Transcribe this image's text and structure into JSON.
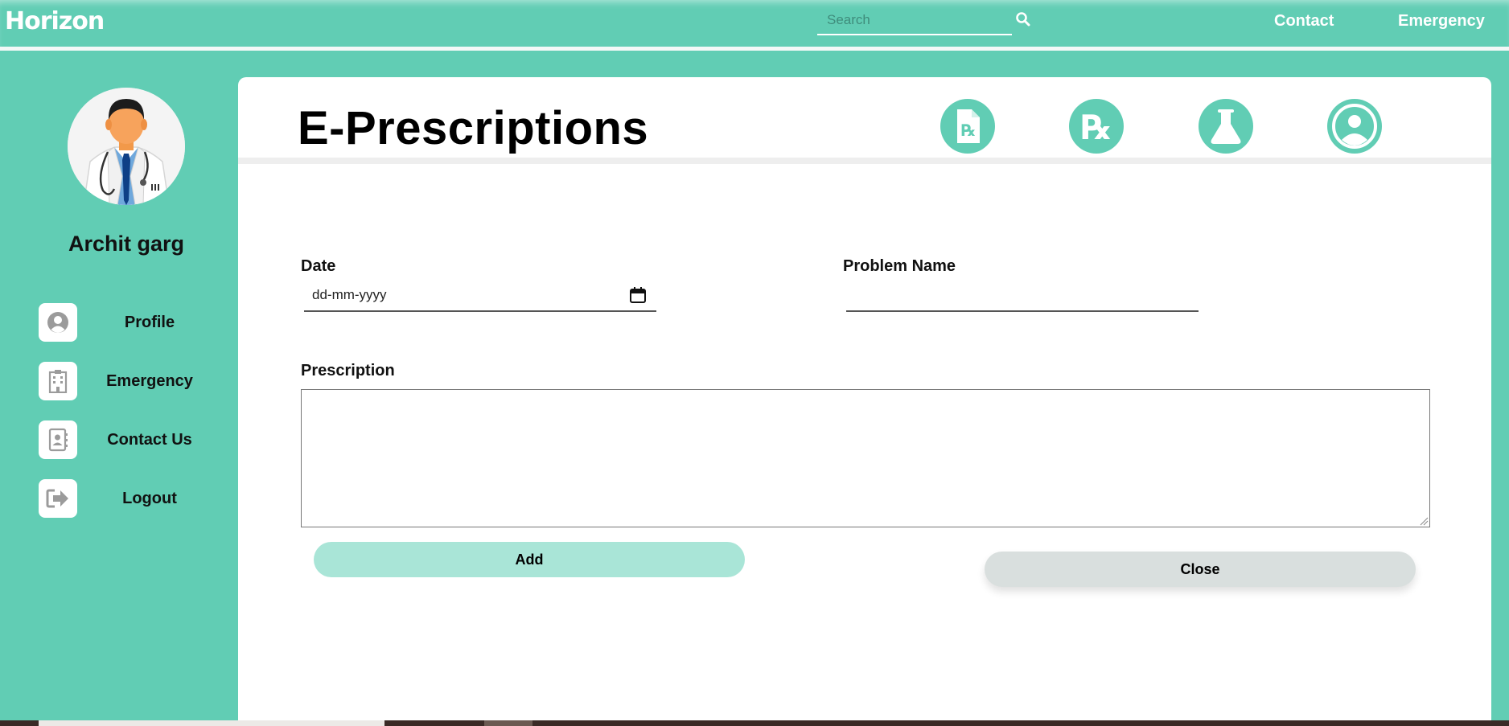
{
  "topbar": {
    "brand": "Horizon",
    "search_placeholder": "Search",
    "links": [
      "Contact",
      "Emergency"
    ]
  },
  "sidebar": {
    "user_name": "Archit garg",
    "items": [
      {
        "label": "Profile",
        "icon": "user-circle-icon"
      },
      {
        "label": "Emergency",
        "icon": "hospital-building-icon"
      },
      {
        "label": "Contact Us",
        "icon": "contact-book-icon"
      },
      {
        "label": "Logout",
        "icon": "logout-icon"
      }
    ]
  },
  "main": {
    "title": "E-Prescriptions",
    "header_icons": [
      "prescription-document-icon",
      "rx-icon",
      "lab-flask-icon",
      "user-circle-icon"
    ],
    "date_label": "Date",
    "date_placeholder": "dd-mm-yyyy",
    "problem_label": "Problem Name",
    "problem_value": "",
    "prescription_label": "Prescription",
    "prescription_value": "",
    "add_label": "Add",
    "close_label": "Close"
  },
  "colors": {
    "accent": "#61cdb4",
    "accent_light": "#a9e5d7",
    "close_button": "#d9dfde",
    "sidebar_icon": "#9b9b9b"
  }
}
